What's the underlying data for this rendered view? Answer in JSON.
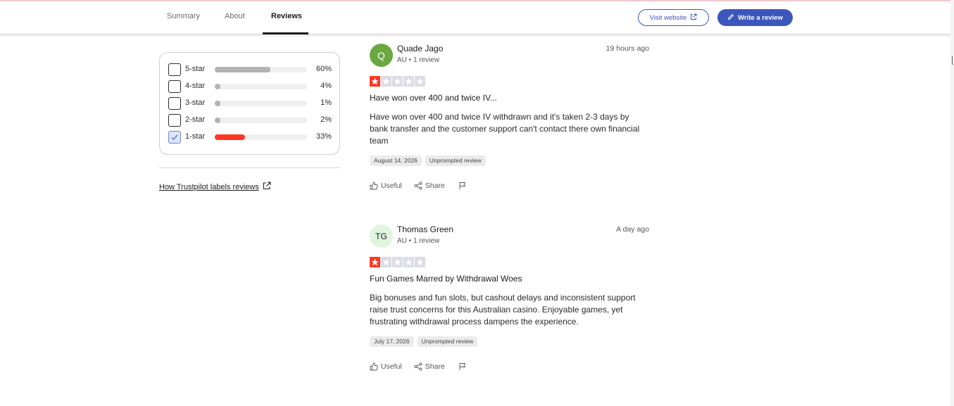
{
  "header": {
    "tabs": [
      {
        "label": "Summary"
      },
      {
        "label": "About"
      },
      {
        "label": "Reviews"
      }
    ],
    "visit_label": "Visit website",
    "write_label": "Write a review"
  },
  "filters": {
    "rows": [
      {
        "label": "5-star",
        "pct": "60%",
        "value": 60,
        "checked": false
      },
      {
        "label": "4-star",
        "pct": "4%",
        "value": 4,
        "checked": false
      },
      {
        "label": "3-star",
        "pct": "1%",
        "value": 1,
        "checked": false
      },
      {
        "label": "2-star",
        "pct": "2%",
        "value": 2,
        "checked": false
      },
      {
        "label": "1-star",
        "pct": "33%",
        "value": 33,
        "checked": true
      }
    ],
    "how_label": "How Trustpilot labels reviews"
  },
  "reviews": [
    {
      "initials": "Q",
      "name": "Quade Jago",
      "meta": "AU • 1 review",
      "time": "19 hours ago",
      "rating": 1,
      "title": "Have won over 400 and twice IV...",
      "text": "Have won over 400 and twice IV withdrawn and it's taken 2-3 days by bank transfer and the customer support can't contact there own financial team",
      "date": "August 14, 2026",
      "tag": "Unprompted review",
      "useful": "Useful",
      "share": "Share"
    },
    {
      "initials": "TG",
      "name": "Thomas Green",
      "meta": "AU • 1 review",
      "time": "A day ago",
      "rating": 1,
      "title": "Fun Games Marred by Withdrawal Woes",
      "text": "Big bonuses and fun slots, but cashout delays and inconsistent support raise trust concerns for this Australian casino. Enjoyable games, yet frustrating withdrawal process dampens the experience.",
      "date": "July 17, 2026",
      "tag": "Unprompted review",
      "useful": "Useful",
      "share": "Share"
    }
  ],
  "colors": {
    "brand": "#3c57bc",
    "star_on": "#ff3722",
    "star_off": "#dcdce6",
    "bar_default": "#b3b3b3",
    "bar_active": "#ff3722",
    "avatar_q": "#6aa83f",
    "avatar_tg_bg": "#dff5df"
  }
}
